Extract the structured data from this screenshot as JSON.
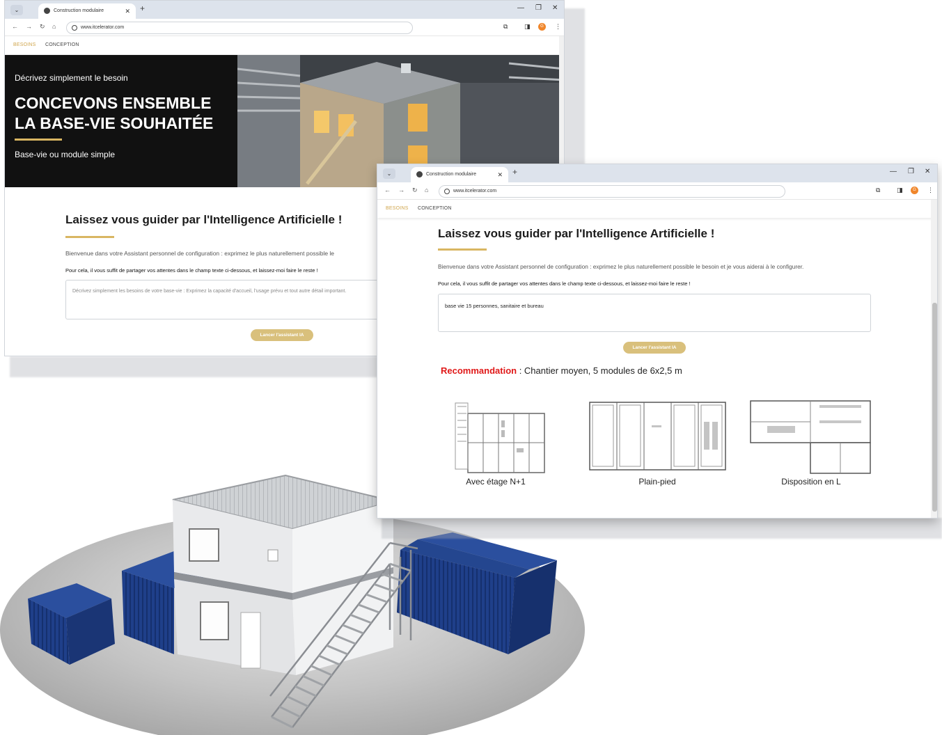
{
  "browser": {
    "tab_title": "Construction modulaire",
    "url": "www.itcelerator.com",
    "profile_initial": "G"
  },
  "site_nav": {
    "besoins": "BESOINS",
    "conception": "CONCEPTION"
  },
  "hero": {
    "kicker": "Décrivez simplement le besoin",
    "title_line1": "CONCEVONS ENSEMBLE",
    "title_line2": "LA BASE-VIE SOUHAITÉE",
    "subtitle": "Base-vie ou module simple"
  },
  "assistant": {
    "heading": "Laissez vous guider par l'Intelligence Artificielle !",
    "welcome_short": "Bienvenue dans votre Assistant personnel de configuration : exprimez le plus naturellement possible le",
    "welcome": "Bienvenue dans votre Assistant personnel de configuration : exprimez le plus naturellement possible le besoin et je vous aiderai à le configurer.",
    "instruction": "Pour cela, il vous suffit de partager vos attentes dans le champ texte ci-dessous, et laissez-moi faire le reste !",
    "placeholder": "Décrivez simplement les besoins de votre base-vie : Exprimez la capacité d'accueil, l'usage prévu et tout autre détail important.",
    "input_value": "base vie 15 personnes, sanitaire et bureau",
    "button": "Lancer l'assistant IA"
  },
  "recommendation": {
    "label": "Recommandation",
    "text": " : Chantier moyen, 5 modules de 6x2,5 m"
  },
  "plans": [
    {
      "caption": "Avec étage N+1"
    },
    {
      "caption": "Plain-pied"
    },
    {
      "caption": "Disposition en L"
    }
  ],
  "colors": {
    "gold": "#d9b662",
    "accent_red": "#e01818",
    "container_blue": "#1f3f8a"
  }
}
